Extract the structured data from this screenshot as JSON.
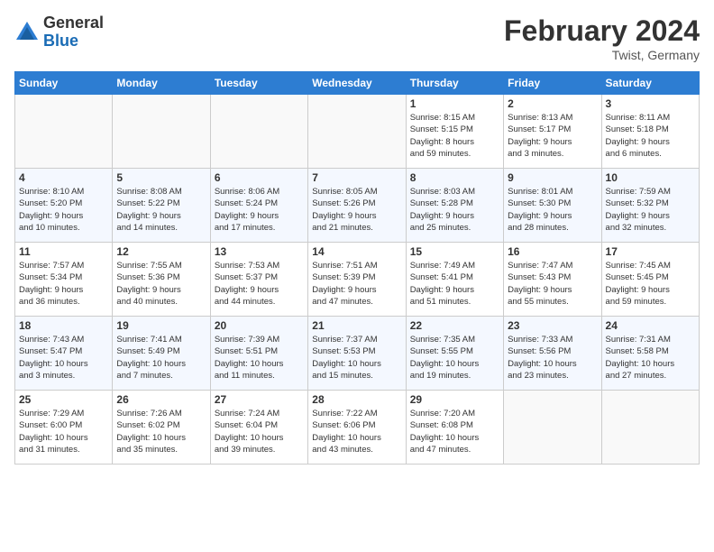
{
  "header": {
    "logo_general": "General",
    "logo_blue": "Blue",
    "month_year": "February 2024",
    "location": "Twist, Germany"
  },
  "days_of_week": [
    "Sunday",
    "Monday",
    "Tuesday",
    "Wednesday",
    "Thursday",
    "Friday",
    "Saturday"
  ],
  "weeks": [
    [
      {
        "day": "",
        "info": ""
      },
      {
        "day": "",
        "info": ""
      },
      {
        "day": "",
        "info": ""
      },
      {
        "day": "",
        "info": ""
      },
      {
        "day": "1",
        "info": "Sunrise: 8:15 AM\nSunset: 5:15 PM\nDaylight: 8 hours\nand 59 minutes."
      },
      {
        "day": "2",
        "info": "Sunrise: 8:13 AM\nSunset: 5:17 PM\nDaylight: 9 hours\nand 3 minutes."
      },
      {
        "day": "3",
        "info": "Sunrise: 8:11 AM\nSunset: 5:18 PM\nDaylight: 9 hours\nand 6 minutes."
      }
    ],
    [
      {
        "day": "4",
        "info": "Sunrise: 8:10 AM\nSunset: 5:20 PM\nDaylight: 9 hours\nand 10 minutes."
      },
      {
        "day": "5",
        "info": "Sunrise: 8:08 AM\nSunset: 5:22 PM\nDaylight: 9 hours\nand 14 minutes."
      },
      {
        "day": "6",
        "info": "Sunrise: 8:06 AM\nSunset: 5:24 PM\nDaylight: 9 hours\nand 17 minutes."
      },
      {
        "day": "7",
        "info": "Sunrise: 8:05 AM\nSunset: 5:26 PM\nDaylight: 9 hours\nand 21 minutes."
      },
      {
        "day": "8",
        "info": "Sunrise: 8:03 AM\nSunset: 5:28 PM\nDaylight: 9 hours\nand 25 minutes."
      },
      {
        "day": "9",
        "info": "Sunrise: 8:01 AM\nSunset: 5:30 PM\nDaylight: 9 hours\nand 28 minutes."
      },
      {
        "day": "10",
        "info": "Sunrise: 7:59 AM\nSunset: 5:32 PM\nDaylight: 9 hours\nand 32 minutes."
      }
    ],
    [
      {
        "day": "11",
        "info": "Sunrise: 7:57 AM\nSunset: 5:34 PM\nDaylight: 9 hours\nand 36 minutes."
      },
      {
        "day": "12",
        "info": "Sunrise: 7:55 AM\nSunset: 5:36 PM\nDaylight: 9 hours\nand 40 minutes."
      },
      {
        "day": "13",
        "info": "Sunrise: 7:53 AM\nSunset: 5:37 PM\nDaylight: 9 hours\nand 44 minutes."
      },
      {
        "day": "14",
        "info": "Sunrise: 7:51 AM\nSunset: 5:39 PM\nDaylight: 9 hours\nand 47 minutes."
      },
      {
        "day": "15",
        "info": "Sunrise: 7:49 AM\nSunset: 5:41 PM\nDaylight: 9 hours\nand 51 minutes."
      },
      {
        "day": "16",
        "info": "Sunrise: 7:47 AM\nSunset: 5:43 PM\nDaylight: 9 hours\nand 55 minutes."
      },
      {
        "day": "17",
        "info": "Sunrise: 7:45 AM\nSunset: 5:45 PM\nDaylight: 9 hours\nand 59 minutes."
      }
    ],
    [
      {
        "day": "18",
        "info": "Sunrise: 7:43 AM\nSunset: 5:47 PM\nDaylight: 10 hours\nand 3 minutes."
      },
      {
        "day": "19",
        "info": "Sunrise: 7:41 AM\nSunset: 5:49 PM\nDaylight: 10 hours\nand 7 minutes."
      },
      {
        "day": "20",
        "info": "Sunrise: 7:39 AM\nSunset: 5:51 PM\nDaylight: 10 hours\nand 11 minutes."
      },
      {
        "day": "21",
        "info": "Sunrise: 7:37 AM\nSunset: 5:53 PM\nDaylight: 10 hours\nand 15 minutes."
      },
      {
        "day": "22",
        "info": "Sunrise: 7:35 AM\nSunset: 5:55 PM\nDaylight: 10 hours\nand 19 minutes."
      },
      {
        "day": "23",
        "info": "Sunrise: 7:33 AM\nSunset: 5:56 PM\nDaylight: 10 hours\nand 23 minutes."
      },
      {
        "day": "24",
        "info": "Sunrise: 7:31 AM\nSunset: 5:58 PM\nDaylight: 10 hours\nand 27 minutes."
      }
    ],
    [
      {
        "day": "25",
        "info": "Sunrise: 7:29 AM\nSunset: 6:00 PM\nDaylight: 10 hours\nand 31 minutes."
      },
      {
        "day": "26",
        "info": "Sunrise: 7:26 AM\nSunset: 6:02 PM\nDaylight: 10 hours\nand 35 minutes."
      },
      {
        "day": "27",
        "info": "Sunrise: 7:24 AM\nSunset: 6:04 PM\nDaylight: 10 hours\nand 39 minutes."
      },
      {
        "day": "28",
        "info": "Sunrise: 7:22 AM\nSunset: 6:06 PM\nDaylight: 10 hours\nand 43 minutes."
      },
      {
        "day": "29",
        "info": "Sunrise: 7:20 AM\nSunset: 6:08 PM\nDaylight: 10 hours\nand 47 minutes."
      },
      {
        "day": "",
        "info": ""
      },
      {
        "day": "",
        "info": ""
      }
    ]
  ]
}
